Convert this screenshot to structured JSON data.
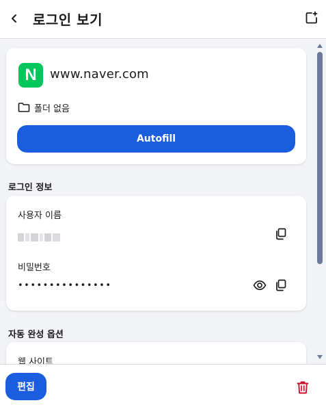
{
  "header": {
    "title": "로그인 보기",
    "back_icon": "chevron-left-icon",
    "export_icon": "popout-icon"
  },
  "site": {
    "logo_letter": "N",
    "name": "www.naver.com",
    "folder_icon": "folder-icon",
    "folder": "폴더 없음",
    "autofill_label": "Autofill"
  },
  "login_info": {
    "section_title": "로그인 정보",
    "username_label": "사용자 이름",
    "password_label": "비밀번호",
    "password_masked": "•••••••••••••••",
    "copy_icon": "copy-icon",
    "eye_icon": "eye-icon"
  },
  "autofill_options": {
    "section_title": "자동 완성 옵션",
    "website_label": "웹 사이트"
  },
  "footer": {
    "edit_label": "편집",
    "delete_icon": "trash-icon"
  },
  "colors": {
    "accent": "#1a5ddf",
    "brand_logo": "#03c75a",
    "danger": "#c8102e",
    "background": "#f3f4f8"
  }
}
